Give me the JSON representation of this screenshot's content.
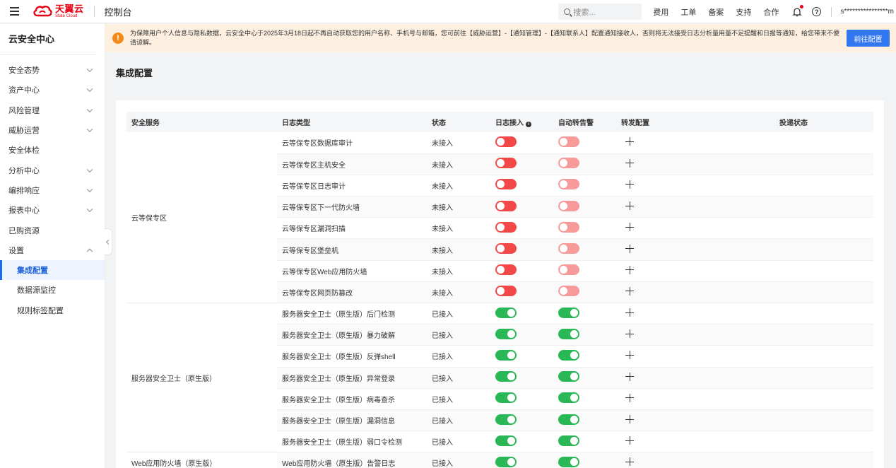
{
  "topbar": {
    "brand_cn": "天翼云",
    "brand_en": "State Cloud",
    "console": "控制台",
    "search_placeholder": "搜索...",
    "links": [
      "费用",
      "工单",
      "备案",
      "支持",
      "合作"
    ],
    "account": "s****************m"
  },
  "sidebar": {
    "title": "云安全中心",
    "items": [
      {
        "label": "安全态势",
        "expand": "down"
      },
      {
        "label": "资产中心",
        "expand": "down"
      },
      {
        "label": "风险管理",
        "expand": "down"
      },
      {
        "label": "威胁运营",
        "expand": "down"
      },
      {
        "label": "安全体检",
        "expand": ""
      },
      {
        "label": "分析中心",
        "expand": "down"
      },
      {
        "label": "编排响应",
        "expand": "down"
      },
      {
        "label": "报表中心",
        "expand": "down"
      },
      {
        "label": "已购资源",
        "expand": ""
      },
      {
        "label": "设置",
        "expand": "up"
      },
      {
        "label": "集成配置",
        "sub": true,
        "active": true
      },
      {
        "label": "数据源监控",
        "sub": true
      },
      {
        "label": "规则标签配置",
        "sub": true
      }
    ]
  },
  "notice": {
    "text": "为保障用户个人信息与隐私数据，云安全中心于2025年3月18日起不再自动获取您的用户名称、手机号与邮箱，您可前往【威胁运营】-【通知管理】-【通知联系人】配置通知接收人，否则将无法接受日志分析量用量不足提醒和日报等通知，给您带来不便请谅解。",
    "button": "前往配置"
  },
  "page": {
    "title": "集成配置"
  },
  "table": {
    "headers": [
      "安全服务",
      "日志类型",
      "状态",
      "日志接入",
      "自动转告警",
      "转发配置",
      "投递状态"
    ],
    "groups": [
      {
        "service": "云等保专区",
        "rows": [
          {
            "type": "云等保专区数据库审计",
            "status": "未接入",
            "log": "off",
            "alert": "off"
          },
          {
            "type": "云等保专区主机安全",
            "status": "未接入",
            "log": "off",
            "alert": "off"
          },
          {
            "type": "云等保专区日志审计",
            "status": "未接入",
            "log": "off",
            "alert": "off"
          },
          {
            "type": "云等保专区下一代防火墙",
            "status": "未接入",
            "log": "off",
            "alert": "off"
          },
          {
            "type": "云等保专区漏洞扫描",
            "status": "未接入",
            "log": "off",
            "alert": "off"
          },
          {
            "type": "云等保专区堡垒机",
            "status": "未接入",
            "log": "off",
            "alert": "off"
          },
          {
            "type": "云等保专区Web应用防火墙",
            "status": "未接入",
            "log": "off",
            "alert": "off"
          },
          {
            "type": "云等保专区网页防篡改",
            "status": "未接入",
            "log": "off",
            "alert": "off"
          }
        ]
      },
      {
        "service": "服务器安全卫士（原生版）",
        "rows": [
          {
            "type": "服务器安全卫士（原生版）后门检测",
            "status": "已接入",
            "log": "on",
            "alert": "on"
          },
          {
            "type": "服务器安全卫士（原生版）暴力破解",
            "status": "已接入",
            "log": "on",
            "alert": "on"
          },
          {
            "type": "服务器安全卫士（原生版）反弹shell",
            "status": "已接入",
            "log": "on",
            "alert": "on"
          },
          {
            "type": "服务器安全卫士（原生版）异常登录",
            "status": "已接入",
            "log": "on",
            "alert": "on"
          },
          {
            "type": "服务器安全卫士（原生版）病毒查杀",
            "status": "已接入",
            "log": "on",
            "alert": "on"
          },
          {
            "type": "服务器安全卫士（原生版）漏洞信息",
            "status": "已接入",
            "log": "on",
            "alert": "on"
          },
          {
            "type": "服务器安全卫士（原生版）弱口令检测",
            "status": "已接入",
            "log": "on",
            "alert": "on"
          }
        ]
      },
      {
        "service": "Web应用防火墙（原生版）",
        "rows": [
          {
            "type": "Web应用防火墙（原生版）告警日志",
            "status": "已接入",
            "log": "on",
            "alert": "on"
          }
        ]
      }
    ]
  },
  "colors": {
    "accent": "#3377f0",
    "toggle_on": "#2ab756",
    "toggle_off_strong": "#f24848",
    "toggle_off_light": "#f79a9a",
    "notice_bg": "#fdf0e0",
    "brand_red": "#e60012"
  },
  "icons": [
    "menu-icon",
    "search-icon",
    "bell-icon",
    "help-icon",
    "info-icon",
    "plus-icon",
    "chevron-down-icon",
    "chevron-up-icon",
    "collapse-icon",
    "warning-icon"
  ]
}
